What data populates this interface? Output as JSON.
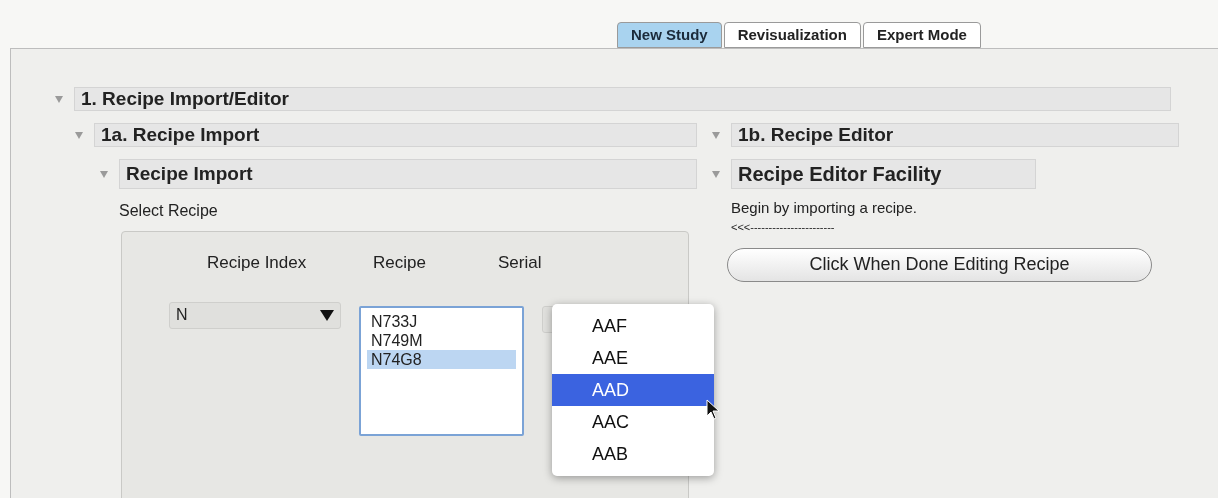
{
  "tabs": [
    {
      "label": "New Study",
      "selected": true
    },
    {
      "label": "Revisualization",
      "selected": false
    },
    {
      "label": "Expert Mode",
      "selected": false
    }
  ],
  "section": {
    "title": "1. Recipe Import/Editor",
    "expanded": true
  },
  "import": {
    "title": "1a. Recipe Import",
    "expanded": true,
    "sub": {
      "title": "Recipe Import",
      "expanded": true
    },
    "select_label": "Select Recipe",
    "columns": [
      "Recipe Index",
      "Recipe",
      "Serial"
    ],
    "index_dropdown": {
      "value": "N"
    },
    "recipe_list": [
      {
        "label": "N733J",
        "selected": false
      },
      {
        "label": "N749M",
        "selected": false
      },
      {
        "label": "N74G8",
        "selected": true
      }
    ],
    "serial_menu": [
      {
        "label": "AAF",
        "selected": false
      },
      {
        "label": "AAE",
        "selected": false
      },
      {
        "label": "AAD",
        "selected": true
      },
      {
        "label": "AAC",
        "selected": false
      },
      {
        "label": "AAB",
        "selected": false
      }
    ]
  },
  "editor": {
    "title": "1b. Recipe Editor",
    "expanded": true,
    "sub": {
      "title": "Recipe Editor Facility",
      "expanded": true
    },
    "message": "Begin by importing a recipe.",
    "arrow_text": "<<<-----------------------",
    "button": "Click When Done Editing Recipe"
  }
}
